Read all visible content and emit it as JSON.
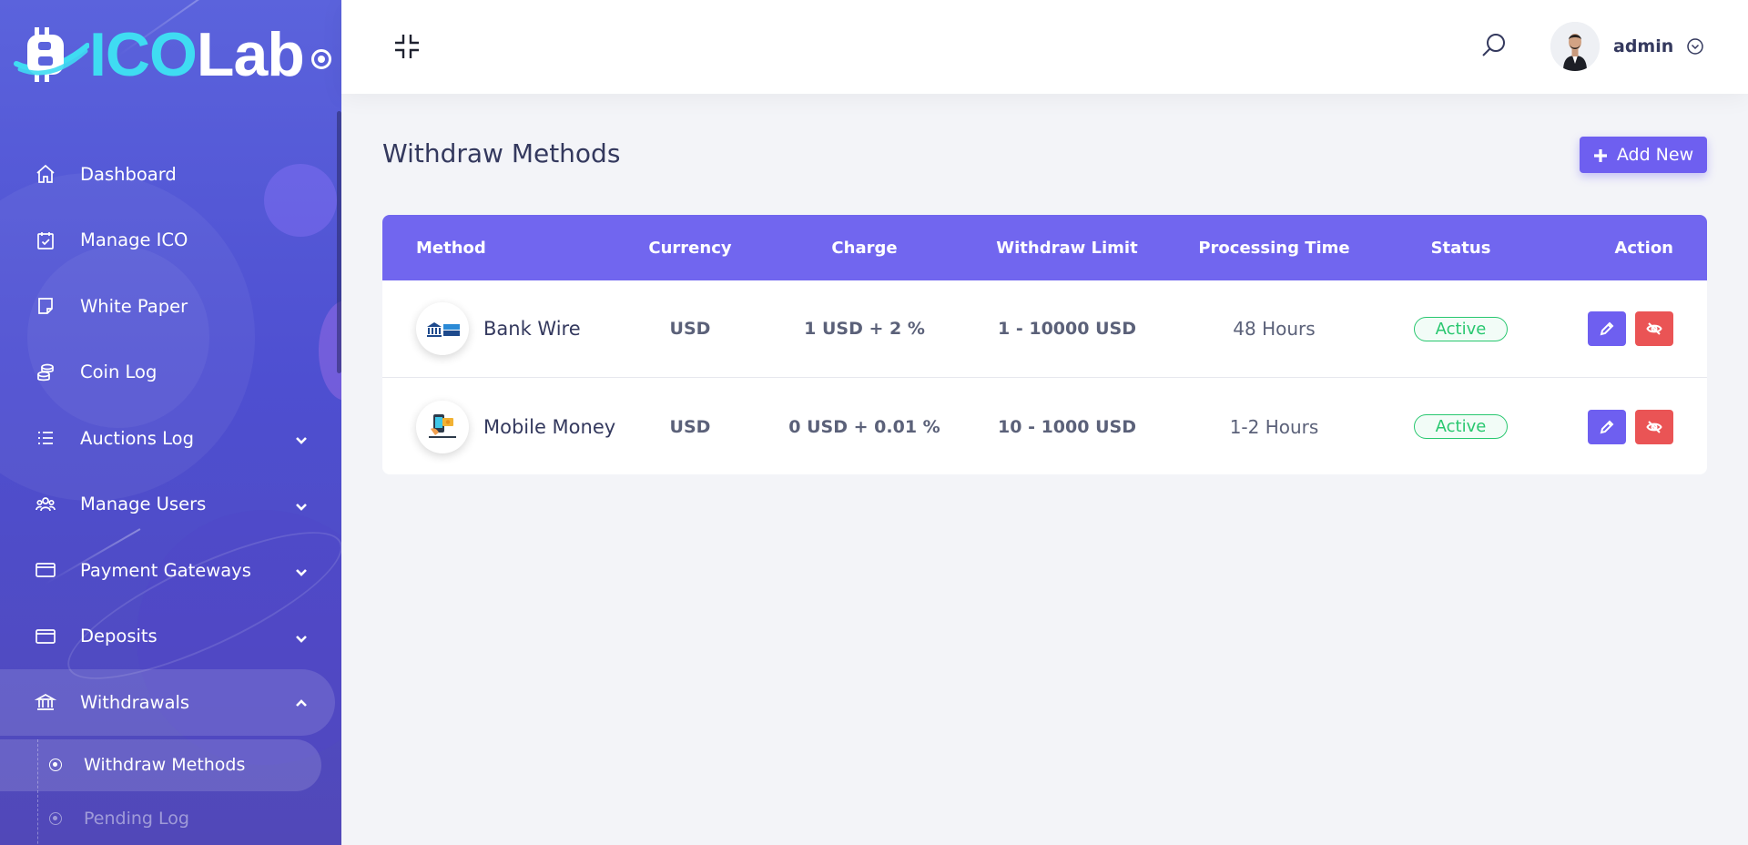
{
  "brand": {
    "ico": "ICO",
    "lab": "Lab"
  },
  "sidebar": {
    "items": [
      {
        "label": "Dashboard",
        "icon": "home-icon"
      },
      {
        "label": "Manage ICO",
        "icon": "calendar-check-icon"
      },
      {
        "label": "White Paper",
        "icon": "note-icon"
      },
      {
        "label": "Coin Log",
        "icon": "coins-icon"
      },
      {
        "label": "Auctions Log",
        "icon": "list-icon",
        "expandable": true
      },
      {
        "label": "Manage Users",
        "icon": "users-icon",
        "expandable": true
      },
      {
        "label": "Payment Gateways",
        "icon": "credit-card-icon",
        "expandable": true
      },
      {
        "label": "Deposits",
        "icon": "credit-card-icon",
        "expandable": true
      },
      {
        "label": "Withdrawals",
        "icon": "bank-icon",
        "expandable": true,
        "open": true
      }
    ],
    "withdrawals_sub": [
      {
        "label": "Withdraw Methods",
        "active": true
      },
      {
        "label": "Pending Log",
        "active": false
      }
    ]
  },
  "topbar": {
    "user_name": "admin"
  },
  "page": {
    "title": "Withdraw Methods",
    "add_new_label": "Add New"
  },
  "table": {
    "headers": {
      "method": "Method",
      "currency": "Currency",
      "charge": "Charge",
      "limit": "Withdraw Limit",
      "time": "Processing Time",
      "status": "Status",
      "action": "Action"
    },
    "rows": [
      {
        "method": "Bank Wire",
        "currency": "USD",
        "charge": "1 USD + 2 %",
        "limit": "1 - 10000 USD",
        "time": "48 Hours",
        "status": "Active"
      },
      {
        "method": "Mobile Money",
        "currency": "USD",
        "charge": "0 USD + 0.01 %",
        "limit": "10 - 1000 USD",
        "time": "1-2 Hours",
        "status": "Active"
      }
    ]
  },
  "colors": {
    "primary": "#6e5ff0",
    "danger": "#ea5455",
    "success": "#28c76f",
    "sidebar": "#5b63dc"
  }
}
